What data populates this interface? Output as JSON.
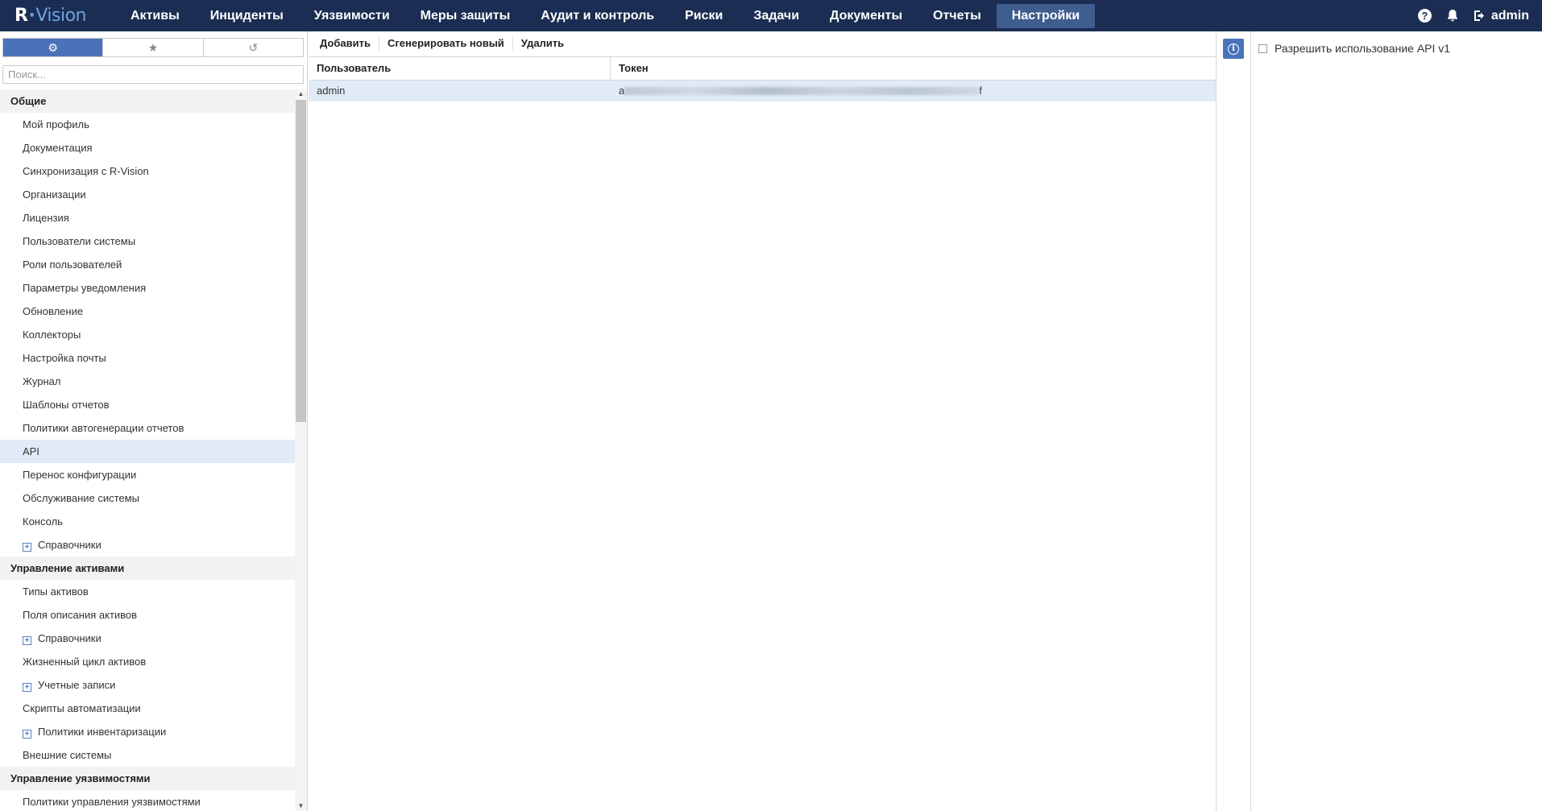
{
  "app": {
    "logo_r": "R",
    "logo_dot": "·",
    "logo_vision": "Vision"
  },
  "nav": {
    "items": [
      {
        "label": "Активы"
      },
      {
        "label": "Инциденты"
      },
      {
        "label": "Уязвимости"
      },
      {
        "label": "Меры защиты"
      },
      {
        "label": "Аудит и контроль"
      },
      {
        "label": "Риски"
      },
      {
        "label": "Задачи"
      },
      {
        "label": "Документы"
      },
      {
        "label": "Отчеты"
      },
      {
        "label": "Настройки",
        "active": true
      }
    ],
    "help_label": "?",
    "user_label": "admin"
  },
  "sidebar": {
    "tabs": [
      {
        "icon": "gear-icon",
        "glyph": "⚙",
        "active": true
      },
      {
        "icon": "star-icon",
        "glyph": "★"
      },
      {
        "icon": "history-icon",
        "glyph": "↺"
      }
    ],
    "search_placeholder": "Поиск...",
    "sections": [
      {
        "title": "Общие",
        "items": [
          {
            "label": "Мой профиль"
          },
          {
            "label": "Документация"
          },
          {
            "label": "Синхронизация с R-Vision"
          },
          {
            "label": "Организации"
          },
          {
            "label": "Лицензия"
          },
          {
            "label": "Пользователи системы"
          },
          {
            "label": "Роли пользователей"
          },
          {
            "label": "Параметры уведомления"
          },
          {
            "label": "Обновление"
          },
          {
            "label": "Коллекторы"
          },
          {
            "label": "Настройка почты"
          },
          {
            "label": "Журнал"
          },
          {
            "label": "Шаблоны отчетов"
          },
          {
            "label": "Политики автогенерации отчетов"
          },
          {
            "label": "API",
            "selected": true
          },
          {
            "label": "Перенос конфигурации"
          },
          {
            "label": "Обслуживание системы"
          },
          {
            "label": "Консоль"
          },
          {
            "label": "Справочники",
            "expandable": true
          }
        ]
      },
      {
        "title": "Управление активами",
        "items": [
          {
            "label": "Типы активов"
          },
          {
            "label": "Поля описания активов"
          },
          {
            "label": "Справочники",
            "expandable": true
          },
          {
            "label": "Жизненный цикл активов"
          },
          {
            "label": "Учетные записи",
            "expandable": true
          },
          {
            "label": "Скрипты автоматизации"
          },
          {
            "label": "Политики инвентаризации",
            "expandable": true
          },
          {
            "label": "Внешние системы"
          }
        ]
      },
      {
        "title": "Управление уязвимостями",
        "items": [
          {
            "label": "Политики управления уязвимостями"
          }
        ]
      }
    ]
  },
  "toolbar": {
    "add_label": "Добавить",
    "generate_label": "Сгенерировать новый",
    "delete_label": "Удалить"
  },
  "table": {
    "columns": [
      "Пользователь",
      "Токен"
    ],
    "rows": [
      {
        "user": "admin",
        "token_start": "a",
        "token_end": "f"
      }
    ]
  },
  "right_panel": {
    "info_glyph": "i",
    "api_option_label": "Разрешить использование API v1",
    "api_option_checked": false
  }
}
